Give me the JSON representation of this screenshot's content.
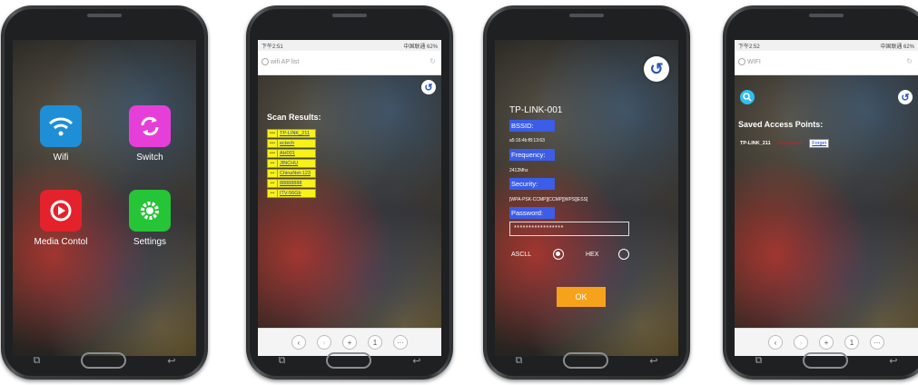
{
  "phone1": {
    "apps": [
      {
        "label": "Wifi",
        "icon": "wifi-icon",
        "color": "#1e8fd6"
      },
      {
        "label": "Switch",
        "icon": "switch-icon",
        "color": "#e63fd9"
      },
      {
        "label": "Media Contol",
        "icon": "media-icon",
        "color": "#e4222b"
      },
      {
        "label": "Settings",
        "icon": "settings-icon",
        "color": "#26c437"
      }
    ]
  },
  "phone2": {
    "status_time": "下午2:51",
    "status_right": "中国联通 62%",
    "url_placeholder": "wifi AP list",
    "scan_title": "Scan Results:",
    "networks": [
      {
        "signal": "****",
        "ssid": "TP-LINK_211"
      },
      {
        "signal": "****",
        "ssid": "ectech"
      },
      {
        "signal": "****",
        "ssid": "AH001"
      },
      {
        "signal": "***",
        "ssid": "JINCHU"
      },
      {
        "signal": "***",
        "ssid": "ChinaNet-123"
      },
      {
        "signal": "***",
        "ssid": "88888888"
      },
      {
        "signal": "***",
        "ssid": "ITV-56Gb"
      }
    ],
    "nav": {
      "back": "‹",
      "forward": "›",
      "add": "+",
      "tabs": "1",
      "more": "···"
    }
  },
  "phone3": {
    "ssid": "TP-LINK-001",
    "bssid_label": "BSSID:",
    "bssid_value": "a5:16:4b:f8:13:63",
    "freq_label": "Frequency:",
    "freq_value": "2412Mhz",
    "security_label": "Security:",
    "security_value": "[WPA-PSK-CCMP][CCMP][WPS][ESS]",
    "password_label": "Password:",
    "password_value": "*****************",
    "radio_ascii": "ASCLL",
    "radio_hex": "HEX",
    "ok": "OK"
  },
  "phone4": {
    "status_time": "下午2:52",
    "status_right": "中国联通 62%",
    "url_placeholder": "WIFI",
    "title": "Saved Access Points:",
    "saved_ssid": "TP-LINK_211",
    "saved_state": "Connected",
    "forget": "Forget",
    "nav": {
      "back": "‹",
      "forward": "›",
      "add": "+",
      "tabs": "1",
      "more": "···"
    }
  },
  "softkeys": {
    "recent": "⧉",
    "back": "↩"
  }
}
